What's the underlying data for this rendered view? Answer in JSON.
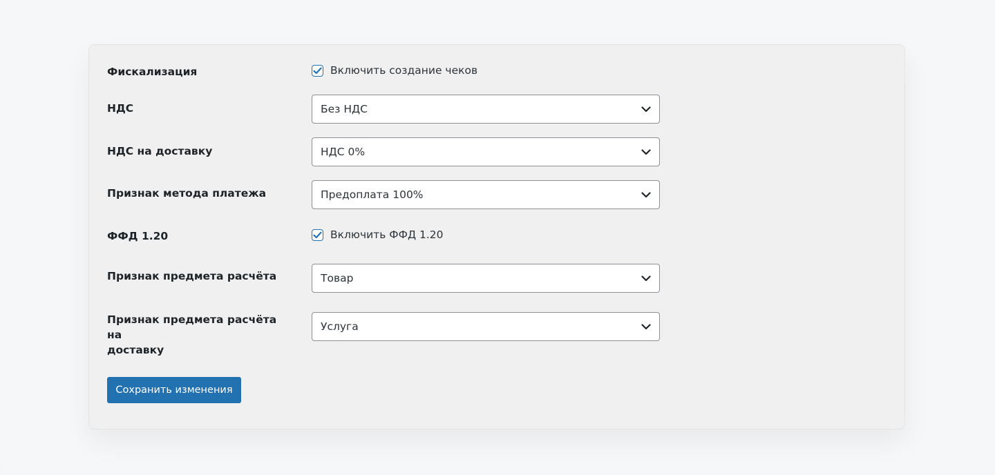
{
  "settings": {
    "fiscalization": {
      "label": "Фискализация",
      "checkbox_label": "Включить создание чеков",
      "checked": true
    },
    "vat": {
      "label": "НДС",
      "value": "Без НДС"
    },
    "vat_delivery": {
      "label": "НДС на доставку",
      "value": "НДС 0%"
    },
    "payment_method": {
      "label": "Признак метода платежа",
      "value": "Предоплата 100%"
    },
    "ffd": {
      "label": "ФФД 1.20",
      "checkbox_label": "Включить ФФД 1.20",
      "checked": true
    },
    "payment_object": {
      "label": "Признак предмета расчёта",
      "value": "Товар"
    },
    "payment_object_delivery": {
      "label_line1": "Признак предмета расчёта на",
      "label_line2": "доставку",
      "value": "Услуга"
    }
  },
  "actions": {
    "save_label": "Сохранить изменения"
  },
  "icons": {
    "checkmark": "check-icon",
    "dropdown": "chevron-down-icon"
  },
  "colors": {
    "accent": "#2271b1",
    "panel": "#f0f0f1",
    "border": "#8c8f94"
  }
}
